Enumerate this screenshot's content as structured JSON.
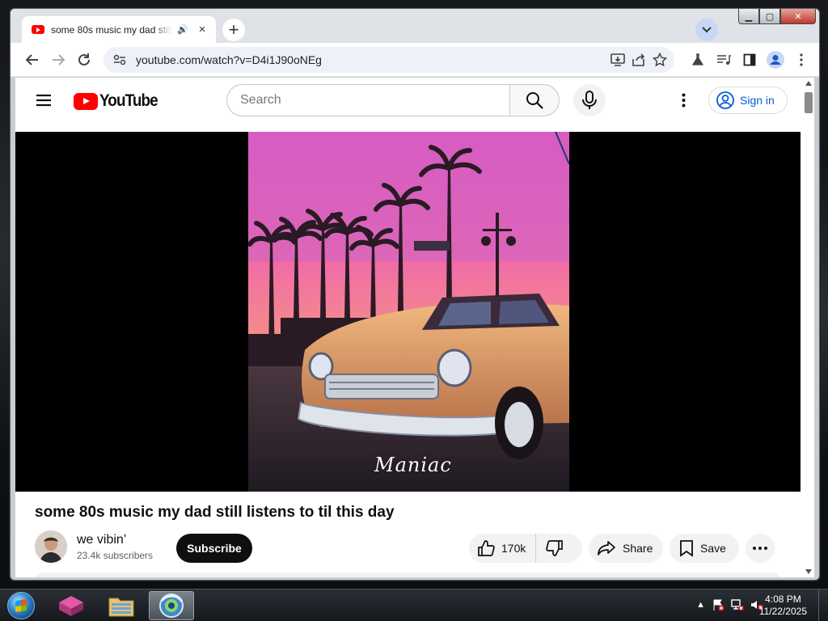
{
  "browser": {
    "tab_title": "some 80s music my dad still listens to til this day",
    "tab_close": "×",
    "new_tab": "+",
    "url": "youtube.com/watch?v=D4i1J90oNEg"
  },
  "window": {
    "minimize": "▁",
    "maximize": "▢",
    "close": "✕"
  },
  "youtube": {
    "logo_text": "YouTube",
    "search_placeholder": "Search",
    "sign_in": "Sign in"
  },
  "video": {
    "watermark": "Maniac",
    "title": "some 80s music my dad still listens to til this day",
    "channel_name": "we vibin’",
    "subscribers": "23.4k subscribers",
    "subscribe_label": "Subscribe",
    "like_count": "170k",
    "share_label": "Share",
    "save_label": "Save"
  },
  "taskbar": {
    "time": "4:08 PM",
    "date": "11/22/2025"
  },
  "colors": {
    "youtube_red": "#ff0000",
    "link_blue": "#065fd4",
    "subscribe_bg": "#0f0f0f"
  }
}
